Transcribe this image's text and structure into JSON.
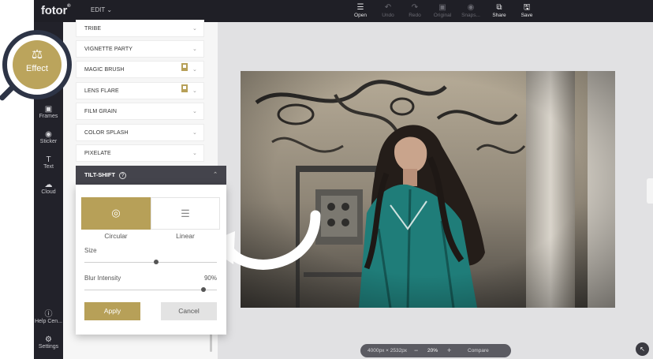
{
  "app": {
    "logo": "fotor",
    "logo_mark": "®",
    "menu": "EDIT",
    "menu_icon": "chevron-down-icon"
  },
  "toolbar": {
    "open": "Open",
    "undo": "Undo",
    "redo": "Redo",
    "original": "Original",
    "snapshot": "Snaps...",
    "share": "Share",
    "save": "Save"
  },
  "sidebar": {
    "effect": "Effect",
    "frames": "Frames",
    "sticker": "Sticker",
    "text": "Text",
    "cloud": "Cloud",
    "help": "Help Cen...",
    "settings": "Settings"
  },
  "effects": [
    {
      "label": "TRIBE",
      "premium": false
    },
    {
      "label": "VIGNETTE PARTY",
      "premium": false
    },
    {
      "label": "MAGIC BRUSH",
      "premium": true
    },
    {
      "label": "LENS FLARE",
      "premium": true
    },
    {
      "label": "FILM GRAIN",
      "premium": false
    },
    {
      "label": "COLOR SPLASH",
      "premium": false
    },
    {
      "label": "PIXELATE",
      "premium": false
    }
  ],
  "tilt_shift": {
    "title": "TILT-SHIFT",
    "help": "?",
    "modes": [
      "Circular",
      "Linear"
    ],
    "selected_mode": "Circular",
    "size_label": "Size",
    "size_value": 0.54,
    "blur_label": "Blur Intensity",
    "blur_value_text": "90%",
    "blur_value": 0.9,
    "apply": "Apply",
    "cancel": "Cancel"
  },
  "status": {
    "dimensions": "4000px × 2532px",
    "zoom_out": "−",
    "zoom": "20%",
    "zoom_in": "+",
    "compare": "Compare"
  },
  "colors": {
    "accent": "#b7a058",
    "topbar": "#1f1f26",
    "sidebar": "#22222a",
    "ring": "#2d3446"
  }
}
